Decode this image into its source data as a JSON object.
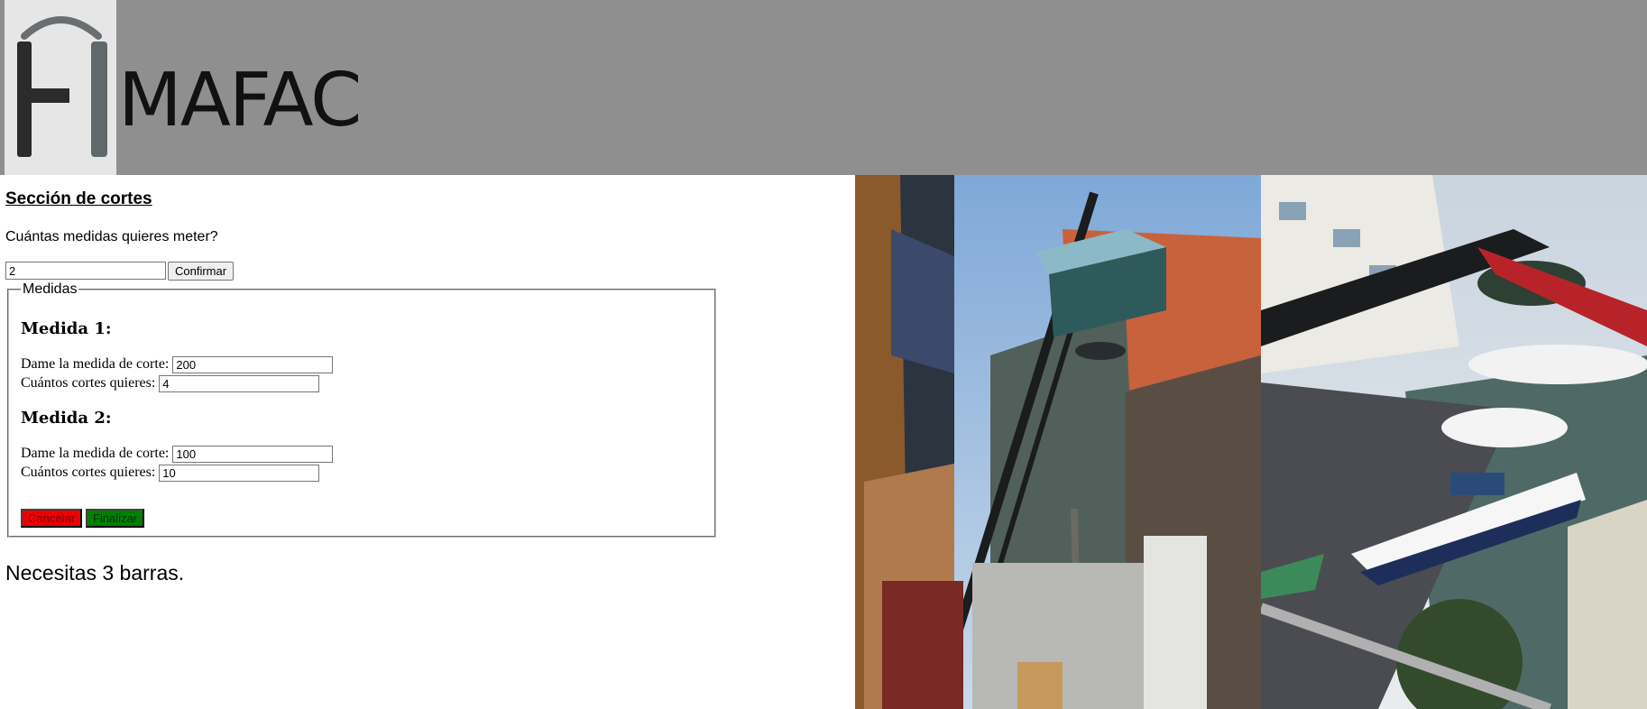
{
  "header": {
    "brand": "MAFAC",
    "background_color": "#8f8f8f"
  },
  "cortes": {
    "title": "Sección de cortes",
    "question": "Cuántas medidas quieres meter?",
    "count_value": "2",
    "confirm_label": "Confirmar",
    "fieldset_legend": "Medidas",
    "medidas": [
      {
        "heading": "Medida 1:",
        "medida_label": "Dame la medida de corte:",
        "medida_value": "200",
        "cortes_label": "Cuántos cortes quieres:",
        "cortes_value": "4"
      },
      {
        "heading": "Medida 2:",
        "medida_label": "Dame la medida de corte:",
        "medida_value": "100",
        "cortes_label": "Cuántos cortes quieres:",
        "cortes_value": "10"
      }
    ],
    "cancel_label": "Cancelar",
    "finish_label": "Finalizar",
    "result_text": "Necesitas 3 barras.",
    "cancel_color": "#ee0000",
    "finish_color": "#008000"
  },
  "images": {
    "photo_1": "crane-lifting-glass-photo",
    "photo_2": "marina-crane-photo"
  }
}
